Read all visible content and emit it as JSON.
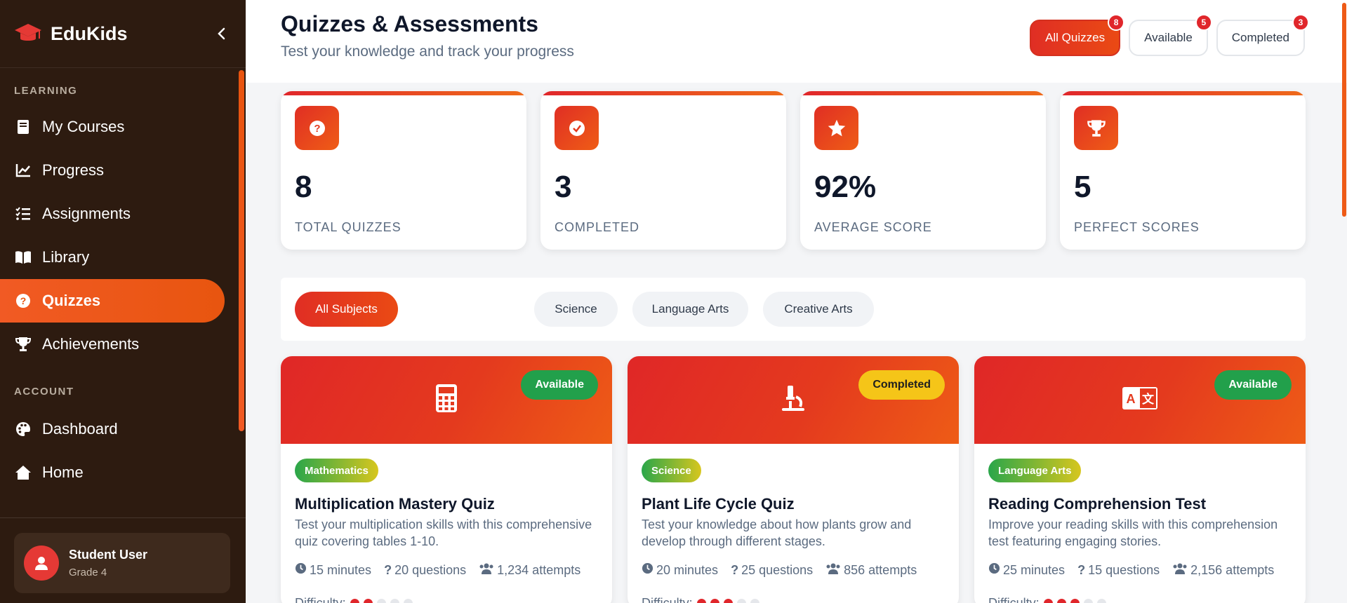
{
  "app": {
    "name": "EduKids",
    "accent": "#f15a24",
    "sidebar_bg": "#2d1b10"
  },
  "sidebar": {
    "sections": [
      {
        "label": "LEARNING",
        "items": [
          {
            "label": "My Courses",
            "icon": "book-icon"
          },
          {
            "label": "Progress",
            "icon": "chart-line-icon"
          },
          {
            "label": "Assignments",
            "icon": "tasks-icon"
          },
          {
            "label": "Library",
            "icon": "open-book-icon"
          },
          {
            "label": "Quizzes",
            "icon": "question-circle-icon",
            "active": true
          },
          {
            "label": "Achievements",
            "icon": "trophy-icon"
          }
        ]
      },
      {
        "label": "ACCOUNT",
        "items": [
          {
            "label": "Dashboard",
            "icon": "palette-icon"
          },
          {
            "label": "Home",
            "icon": "home-icon"
          }
        ]
      }
    ],
    "user": {
      "name": "Student User",
      "grade": "Grade 4"
    }
  },
  "header": {
    "title": "Quizzes & Assessments",
    "subtitle": "Test your knowledge and track your progress",
    "tabs": [
      {
        "label": "All Quizzes",
        "count": "8",
        "active": true
      },
      {
        "label": "Available",
        "count": "5"
      },
      {
        "label": "Completed",
        "count": "3"
      }
    ]
  },
  "stats": [
    {
      "value": "8",
      "label": "TOTAL QUIZZES",
      "icon": "question-circle-icon"
    },
    {
      "value": "3",
      "label": "COMPLETED",
      "icon": "check-circle-icon"
    },
    {
      "value": "92%",
      "label": "AVERAGE SCORE",
      "icon": "star-icon"
    },
    {
      "value": "5",
      "label": "PERFECT SCORES",
      "icon": "trophy-icon"
    }
  ],
  "subjects": [
    {
      "label": "All Subjects",
      "active": true
    },
    {
      "label": "Science"
    },
    {
      "label": "Language Arts"
    },
    {
      "label": "Creative Arts"
    }
  ],
  "quizzes": [
    {
      "status": "Available",
      "subject": "Mathematics",
      "icon": "calculator-icon",
      "title": "Multiplication Mastery Quiz",
      "description": "Test your multiplication skills with this comprehensive quiz covering tables 1-10.",
      "time": "15 minutes",
      "questions": "20 questions",
      "attempts": "1,234 attempts",
      "difficulty_label": "Difficulty:",
      "difficulty": 2
    },
    {
      "status": "Completed",
      "subject": "Science",
      "icon": "microscope-icon",
      "title": "Plant Life Cycle Quiz",
      "description": "Test your knowledge about how plants grow and develop through different stages.",
      "time": "20 minutes",
      "questions": "25 questions",
      "attempts": "856 attempts",
      "difficulty_label": "Difficulty:",
      "difficulty": 3
    },
    {
      "status": "Available",
      "subject": "Language Arts",
      "icon": "language-icon",
      "title": "Reading Comprehension Test",
      "description": "Improve your reading skills with this comprehension test featuring engaging stories.",
      "time": "25 minutes",
      "questions": "15 questions",
      "attempts": "2,156 attempts",
      "difficulty_label": "Difficulty:",
      "difficulty": 3
    }
  ]
}
